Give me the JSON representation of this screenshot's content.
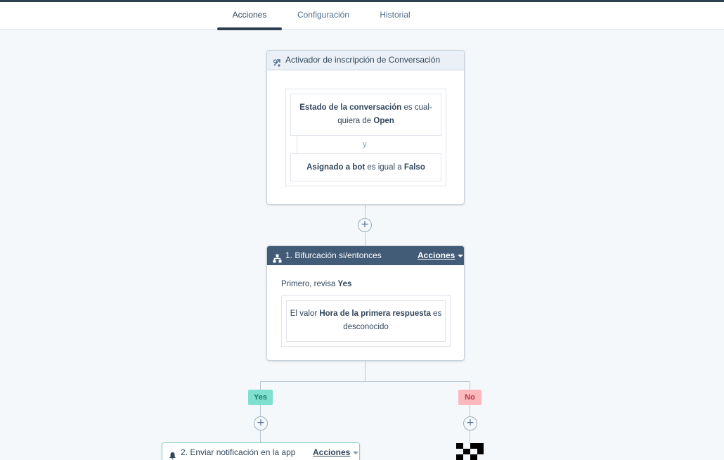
{
  "tabs": [
    {
      "label": "Acciones",
      "active": true
    },
    {
      "label": "Configuración",
      "active": false
    },
    {
      "label": "Historial",
      "active": false
    }
  ],
  "trigger": {
    "icon": "trigger-icon",
    "title": "Activador de inscripción de Conversación",
    "filter1": {
      "prop": "Estado de la conversación",
      "op_line1": " es cual-",
      "op_line2": "quiera de ",
      "value": "Open"
    },
    "joiner": "y",
    "filter2": {
      "prop": "Asignado a bot",
      "op": " es igual a ",
      "value": "Falso"
    }
  },
  "branch": {
    "icon": "branch-icon",
    "title": "1. Bifurcación si/entonces",
    "actions_label": "Acciones",
    "check_prefix": "Primero, revisa ",
    "check_value": "Yes",
    "condition": {
      "prefix": "El valor ",
      "prop": "Hora de la primera respuesta",
      "suffix_line1": " es",
      "suffix_line2": "desconocido"
    }
  },
  "branch_labels": {
    "yes": "Yes",
    "no": "No"
  },
  "add_button_symbol": "+",
  "notification": {
    "icon": "bell-icon",
    "title": "2. Enviar notificación en la app",
    "actions_label": "Acciones"
  },
  "colors": {
    "header_dark": "#425b76",
    "yes_bg": "#7fe0cf",
    "no_bg": "#fbb8bd",
    "canvas_bg": "#f5f8fa"
  }
}
